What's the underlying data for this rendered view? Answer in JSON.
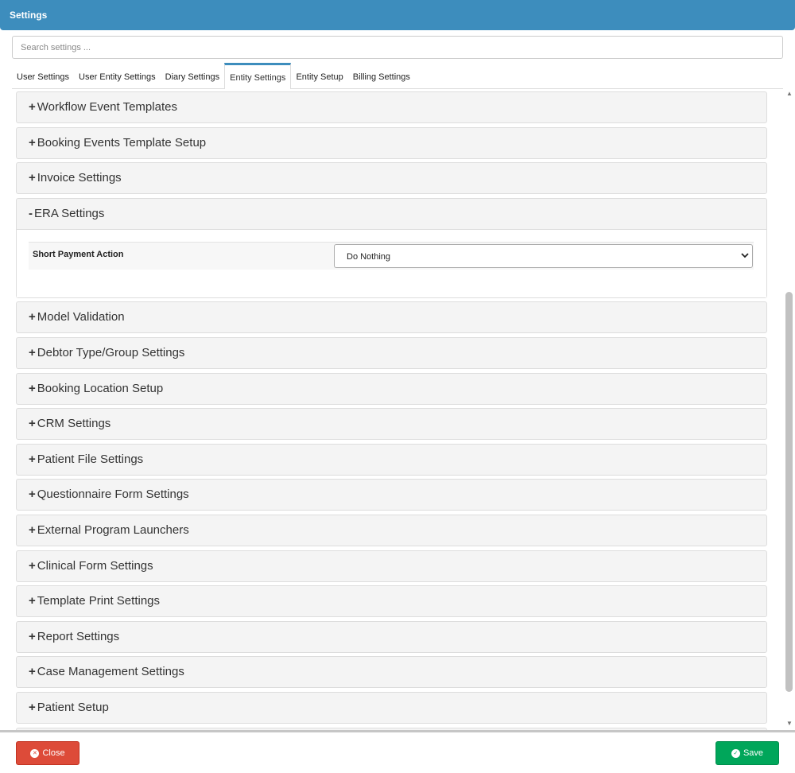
{
  "header": {
    "title": "Settings"
  },
  "search": {
    "placeholder": "Search settings ..."
  },
  "tabs": [
    "User Settings",
    "User Entity Settings",
    "Diary Settings",
    "Entity Settings",
    "Entity Setup",
    "Billing Settings"
  ],
  "active_tab": "Entity Settings",
  "panels": [
    {
      "label": "Workflow Event Templates",
      "toggle": "+"
    },
    {
      "label": "Booking Events Template Setup",
      "toggle": "+"
    },
    {
      "label": "Invoice Settings",
      "toggle": "+"
    },
    {
      "label": "ERA Settings",
      "toggle": "-",
      "expanded": true
    },
    {
      "label": "Model Validation",
      "toggle": "+"
    },
    {
      "label": "Debtor Type/Group Settings",
      "toggle": "+"
    },
    {
      "label": "Booking Location Setup",
      "toggle": "+"
    },
    {
      "label": "CRM Settings",
      "toggle": "+"
    },
    {
      "label": "Patient File Settings",
      "toggle": "+"
    },
    {
      "label": "Questionnaire Form Settings",
      "toggle": "+"
    },
    {
      "label": "External Program Launchers",
      "toggle": "+"
    },
    {
      "label": "Clinical Form Settings",
      "toggle": "+"
    },
    {
      "label": "Template Print Settings",
      "toggle": "+"
    },
    {
      "label": "Report Settings",
      "toggle": "+"
    },
    {
      "label": "Case Management Settings",
      "toggle": "+"
    },
    {
      "label": "Patient Setup",
      "toggle": "+"
    },
    {
      "label": "",
      "toggle": ""
    }
  ],
  "era": {
    "field_label": "Short Payment Action",
    "value": "Do Nothing"
  },
  "footer": {
    "close_label": "Close",
    "save_label": "Save"
  },
  "colors": {
    "header": "#3d8dbd",
    "close": "#dd4b39",
    "save": "#00a65a"
  }
}
